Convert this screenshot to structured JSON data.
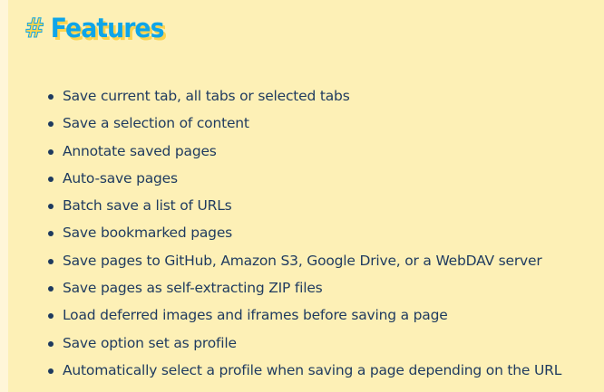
{
  "heading": {
    "hash": "#",
    "title": "Features"
  },
  "features": [
    "Save current tab, all tabs or selected tabs",
    "Save a selection of content",
    "Annotate saved pages",
    "Auto-save pages",
    "Batch save a list of URLs",
    "Save bookmarked pages",
    "Save pages to GitHub, Amazon S3, Google Drive, or a WebDAV server",
    "Save pages as self-extracting ZIP files",
    "Load deferred images and iframes before saving a page",
    "Save option set as profile",
    "Automatically select a profile when saving a page depending on the URL"
  ],
  "colors": {
    "background": "#fdf0b6",
    "heading": "#0ea5e9",
    "accent": "#fcd34d",
    "text": "#1e3a5f"
  }
}
